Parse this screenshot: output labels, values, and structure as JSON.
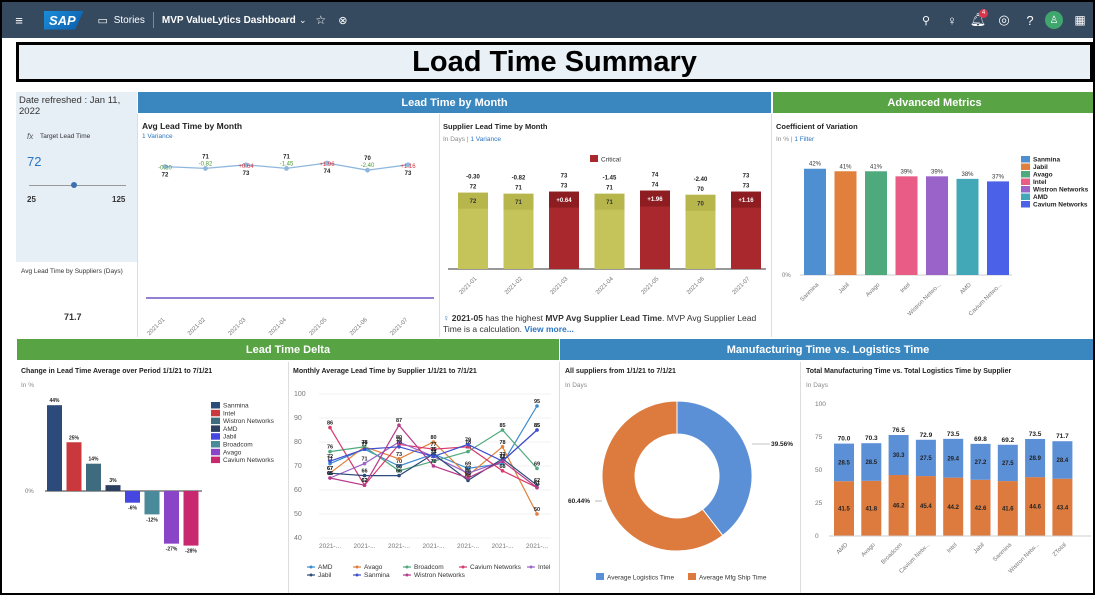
{
  "shell": {
    "stories": "Stories",
    "dashboard": "MVP ValueLytics Dashboard",
    "notif_count": "4"
  },
  "title": "Load Time Summary",
  "left": {
    "refreshed": "Date refreshed : Jan 11, 2022",
    "target_label": "Target Lead Time",
    "target_value": "72",
    "slider_min": "25",
    "slider_max": "125",
    "slider_value": 72,
    "avg_label": "Avg Lead Time by Suppliers (Days)",
    "avg_value": "71.7"
  },
  "headers": {
    "lead_time_month": "Lead Time by Month",
    "advanced": "Advanced Metrics",
    "delta": "Lead Time Delta",
    "mfg_log": "Manufacturing Time vs. Logistics Time"
  },
  "charts": {
    "avg_title": "Avg Lead Time by Month",
    "avg_sub": "1 Variance",
    "sup_title": "Supplier Lead Time by Month",
    "sup_sub_units": "In Days",
    "sup_sub": "1 Variance",
    "critical": "Critical",
    "insight_date": "2021-05",
    "insight_text1": " has the highest ",
    "insight_bold": "MVP Avg Supplier Lead Time",
    "insight_text2": ". MVP Avg Supplier Lead Time is a calculation. ",
    "insight_more": "View more...",
    "cov_title": "Coefficient of Variation",
    "cov_units": "In %",
    "cov_filter": "1 Filter",
    "chg_title": "Change in Lead Time Average over Period 1/1/21 to 7/1/21",
    "chg_units": "In %",
    "mon_title": "Monthly Average Lead Time by Supplier 1/1/21 to 7/1/21",
    "all_title": "All suppliers from 1/1/21 to 7/1/21",
    "all_units": "In Days",
    "tot_title": "Total Manufacturing Time vs. Total Logistics Time by Supplier",
    "tot_units": "In Days"
  },
  "chart_data": [
    {
      "type": "line",
      "title": "Avg Lead Time by Month",
      "x": [
        "2021-01",
        "2021-02",
        "2021-03",
        "2021-04",
        "2021-05",
        "2021-06",
        "2021-07"
      ],
      "series": [
        {
          "values": [
            72,
            71,
            73,
            71,
            74,
            70,
            73
          ]
        },
        {
          "values": [
            -0.3,
            -0.82,
            0.64,
            -1.45,
            1.96,
            -2.4,
            1.16
          ]
        }
      ]
    },
    {
      "type": "bar",
      "title": "Supplier Lead Time by Month",
      "categories": [
        "2021-01",
        "2021-02",
        "2021-03",
        "2021-04",
        "2021-05",
        "2021-06",
        "2021-07"
      ],
      "values": [
        72,
        71,
        73,
        71,
        74,
        70,
        73
      ],
      "variance": [
        -0.3,
        -0.82,
        0.64,
        -1.45,
        1.96,
        -2.4,
        1.16
      ],
      "critical": [
        false,
        false,
        true,
        false,
        true,
        false,
        true
      ],
      "legend": [
        "Critical"
      ],
      "colors": {
        "normal": "#c4c45b",
        "critical": "#a8282e",
        "variance_neg": "#2f5d8a"
      }
    },
    {
      "type": "bar",
      "title": "Coefficient of Variation",
      "categories": [
        "Sanmina",
        "Jabil",
        "Avago",
        "Intel",
        "Wistron Netwo...",
        "AMD",
        "Cavium Netwo..."
      ],
      "legend": [
        "Sanmina",
        "Jabil",
        "Avago",
        "Intel",
        "Wistron Networks",
        "AMD",
        "Cavium Networks"
      ],
      "values": [
        42,
        41,
        41,
        39,
        39,
        38,
        37
      ],
      "labels": [
        "42%",
        "41%",
        "41%",
        "39%",
        "39%",
        "38%",
        "37%"
      ],
      "colors": [
        "#4d8fd1",
        "#e0803c",
        "#4ea97c",
        "#e85c86",
        "#9a63c9",
        "#42a8b8",
        "#4b62e8"
      ]
    },
    {
      "type": "bar",
      "title": "Change in Lead Time Average over Period 1/1/21 to 7/1/21",
      "legend": [
        "Sanmina",
        "Intel",
        "Wistron Networks",
        "AMD",
        "Jabil",
        "Broadcom",
        "Avago",
        "Cavium Networks"
      ],
      "values": [
        44,
        25,
        14,
        3,
        -6,
        -12,
        -27,
        -28
      ],
      "labels": [
        "44%",
        "25%",
        "14%",
        "3%",
        "-6%",
        "-12%",
        "-27%",
        "-28%"
      ],
      "colors": [
        "#2c4a7a",
        "#c8383c",
        "#3e6b7e",
        "#2c3f5e",
        "#4646e0",
        "#4a8a9a",
        "#8a44c8",
        "#c8286e"
      ]
    },
    {
      "type": "line",
      "title": "Monthly Average Lead Time by Supplier 1/1/21 to 7/1/21",
      "ylim": [
        40,
        100
      ],
      "yticks": [
        40,
        50,
        60,
        70,
        80,
        90,
        100
      ],
      "x": [
        "2021-...",
        "2021-...",
        "2021-...",
        "2021-...",
        "2021-...",
        "2021-...",
        "2021-..."
      ],
      "series": [
        {
          "name": "AMD",
          "color": "#3a8ad0",
          "values": [
            71,
            77,
            70,
            75,
            69,
            71,
            95
          ]
        },
        {
          "name": "Avago",
          "color": "#e0803c",
          "values": [
            67,
            78,
            73,
            80,
            66,
            78,
            50
          ]
        },
        {
          "name": "Broadcom",
          "color": "#4ea97c",
          "values": [
            76,
            78,
            68,
            72,
            76,
            85,
            69
          ]
        },
        {
          "name": "Cavium Networks",
          "color": "#d83a6a",
          "values": [
            86,
            62,
            79,
            77,
            78,
            68,
            61
          ]
        },
        {
          "name": "Intel",
          "color": "#9a63c9",
          "values": [
            65,
            71,
            80,
            74,
            67,
            72,
            85
          ]
        },
        {
          "name": "Jabil",
          "color": "#2c4a7a",
          "values": [
            67,
            66,
            66,
            75,
            64,
            73,
            62
          ]
        },
        {
          "name": "Sanmina",
          "color": "#3c4fd0",
          "values": [
            72,
            77,
            78,
            74,
            79,
            72,
            85
          ]
        },
        {
          "name": "Wistron Networks",
          "color": "#b83a8a",
          "values": [
            65,
            62,
            87,
            70,
            65,
            72,
            61
          ]
        }
      ]
    },
    {
      "type": "pie",
      "title": "All suppliers from 1/1/21 to 7/1/21",
      "legend": [
        "Average Logistics Time",
        "Average Mfg Ship Time"
      ],
      "values": [
        39.56,
        60.44
      ],
      "labels": [
        "39.56%",
        "60.44%"
      ],
      "colors": [
        "#5b8fd6",
        "#dd7a3e"
      ]
    },
    {
      "type": "bar",
      "title": "Total Manufacturing Time vs. Total Logistics Time by Supplier",
      "ylim": [
        0,
        100
      ],
      "yticks": [
        0,
        25,
        50,
        75,
        100
      ],
      "categories": [
        "AMD",
        "Avago",
        "Broadcom",
        "Cavium Netw...",
        "Intel",
        "Jabil",
        "Sanmina",
        "Wistron Netw...",
        "ZTotal"
      ],
      "series": [
        {
          "name": "Average Mfg Ship Time",
          "color": "#dd7a3e",
          "values": [
            41.5,
            41.8,
            46.2,
            45.4,
            44.2,
            42.6,
            41.6,
            44.6,
            43.4
          ]
        },
        {
          "name": "Average Logistics Time",
          "color": "#5b8fd6",
          "values": [
            28.5,
            28.5,
            30.3,
            27.5,
            29.4,
            27.2,
            27.5,
            28.9,
            28.4
          ]
        }
      ],
      "totals": [
        "70.0",
        "70.3",
        "76.5",
        "72.9",
        "73.5",
        "69.8",
        "69.2",
        "73.5",
        "71.7"
      ]
    }
  ]
}
